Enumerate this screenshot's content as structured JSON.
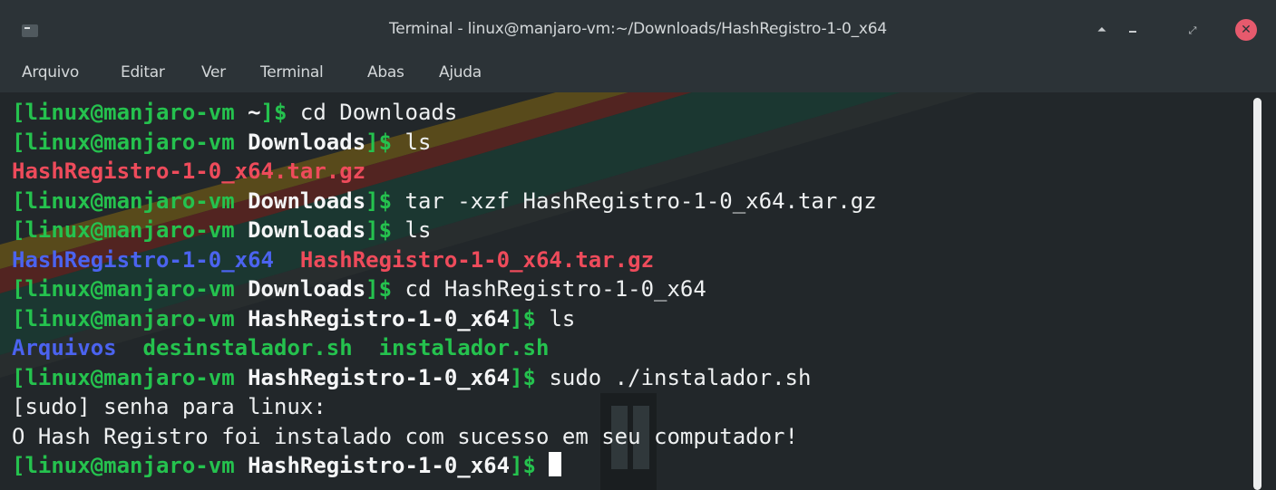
{
  "window": {
    "title": "Terminal - linux@manjaro-vm:~/Downloads/HashRegistro-1-0_x64",
    "buttons": {
      "shade": "⏶",
      "maximize": "⤢",
      "close": "✕"
    }
  },
  "menu": {
    "items": [
      "Arquivo",
      "Editar",
      "Ver",
      "Terminal",
      "Abas",
      "Ajuda"
    ]
  },
  "terminal": {
    "lines": [
      {
        "type": "prompt",
        "user": "[linux@manjaro-vm ",
        "dir": "~",
        "dollar": "]$ ",
        "cmd": "cd Downloads"
      },
      {
        "type": "prompt",
        "user": "[linux@manjaro-vm ",
        "dir": "Downloads",
        "dollar": "]$ ",
        "cmd": "ls"
      },
      {
        "type": "ls",
        "items": [
          {
            "text": "HashRegistro-1-0_x64.tar.gz",
            "kind": "archive"
          }
        ]
      },
      {
        "type": "prompt",
        "user": "[linux@manjaro-vm ",
        "dir": "Downloads",
        "dollar": "]$ ",
        "cmd": "tar -xzf HashRegistro-1-0_x64.tar.gz"
      },
      {
        "type": "prompt",
        "user": "[linux@manjaro-vm ",
        "dir": "Downloads",
        "dollar": "]$ ",
        "cmd": "ls"
      },
      {
        "type": "ls",
        "items": [
          {
            "text": "HashRegistro-1-0_x64",
            "kind": "dir"
          },
          {
            "text": "HashRegistro-1-0_x64.tar.gz",
            "kind": "archive"
          }
        ]
      },
      {
        "type": "prompt",
        "user": "[linux@manjaro-vm ",
        "dir": "Downloads",
        "dollar": "]$ ",
        "cmd": "cd HashRegistro-1-0_x64"
      },
      {
        "type": "prompt",
        "user": "[linux@manjaro-vm ",
        "dir": "HashRegistro-1-0_x64",
        "dollar": "]$ ",
        "cmd": "ls"
      },
      {
        "type": "ls",
        "items": [
          {
            "text": "Arquivos",
            "kind": "dir"
          },
          {
            "text": "desinstalador.sh",
            "kind": "exec"
          },
          {
            "text": "instalador.sh",
            "kind": "exec"
          }
        ]
      },
      {
        "type": "prompt",
        "user": "[linux@manjaro-vm ",
        "dir": "HashRegistro-1-0_x64",
        "dollar": "]$ ",
        "cmd": "sudo ./instalador.sh"
      },
      {
        "type": "output",
        "text": "[sudo] senha para linux:"
      },
      {
        "type": "output",
        "text": "O Hash Registro foi instalado com sucesso em seu computador!"
      },
      {
        "type": "prompt",
        "user": "[linux@manjaro-vm ",
        "dir": "HashRegistro-1-0_x64",
        "dollar": "]$ ",
        "cmd": "",
        "cursor": true
      }
    ]
  },
  "colors": {
    "prompt_green": "#25c24e",
    "archive_red": "#ee4b5b",
    "directory_blue": "#4b63ef",
    "background": "#22272a",
    "titlebar": "#2c3337"
  }
}
